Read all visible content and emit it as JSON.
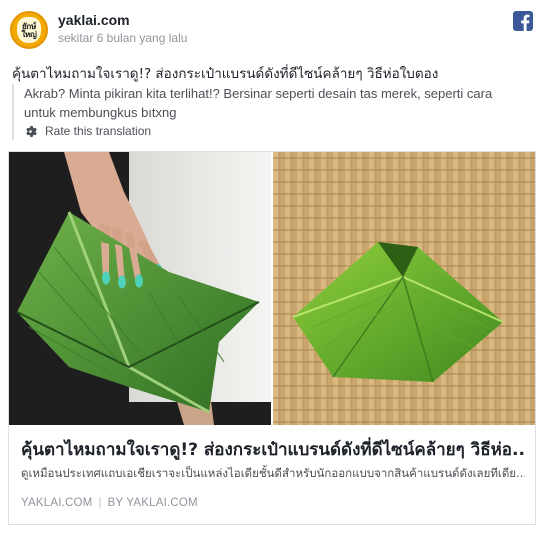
{
  "post": {
    "page_name": "yaklai.com",
    "timestamp": "sekitar 6 bulan yang lalu",
    "avatar_text": "ยักษ์ใหญ่",
    "text": "คุ้นตาไหมถามใจเราดู!? ส่องกระเป๋าแบรนด์ดังที่ดีไซน์คล้ายๆ วิธีห่อใบตอง"
  },
  "translation": {
    "text": "Akrab? Minta pikiran kita terlihat!? Bersinar seperti desain tas merek, seperti cara untuk membungkus bıtxng",
    "rate_label": "Rate this translation"
  },
  "link_card": {
    "title": "คุ้นตาไหมถามใจเราดู!? ส่องกระเป๋าแบรนด์ดังที่ดีไซน์คล้ายๆ วิธีห่อ...",
    "description": "ดูเหมือนประเทศแถบเอเชียเราจะเป็นแหล่งไอเดียชั้นดีสำหรับนักออกแบบจากสินค้าแบรนด์ดังเลยทีเดีย...",
    "domain": "YAKLAI.COM",
    "separator": "|",
    "by_label": "BY",
    "by_name": "YAKLAI.COM"
  },
  "icons": {
    "facebook": "facebook-icon",
    "gear": "gear-icon"
  },
  "colors": {
    "facebook_blue": "#3b5998",
    "text_dark": "#1d2129",
    "text_muted": "#90949c",
    "border": "#dddfe2",
    "banana_leaf": "#4f9a34",
    "wicker": "#c9a46a"
  }
}
